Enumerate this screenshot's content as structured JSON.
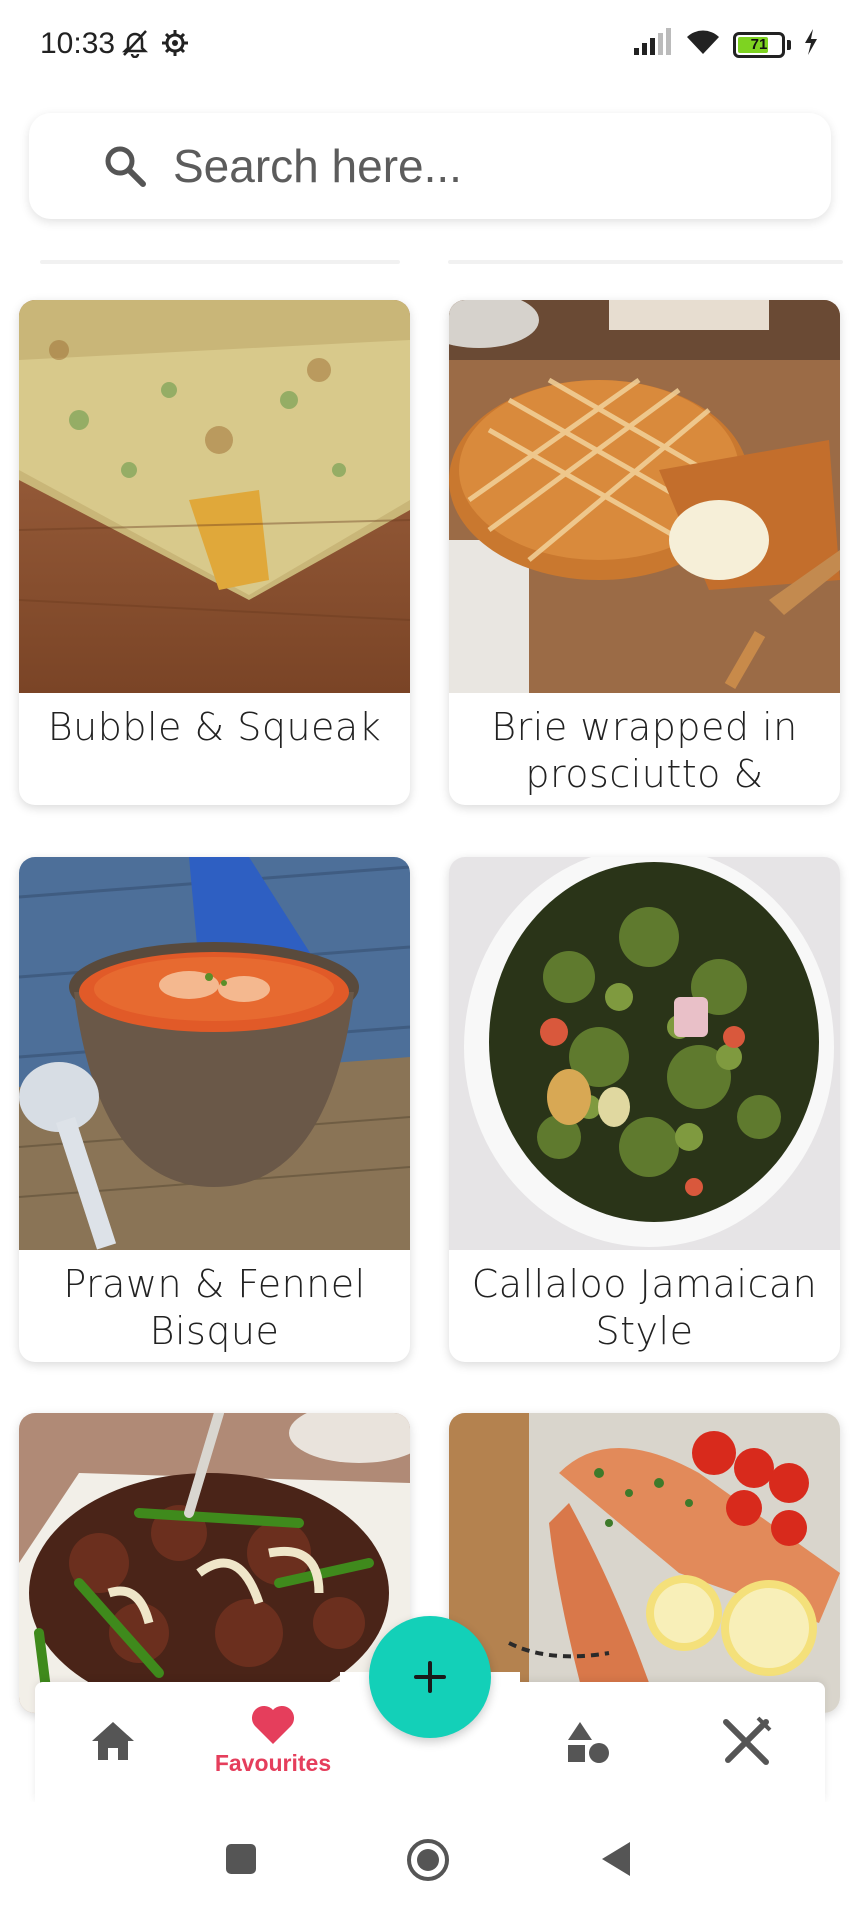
{
  "status_bar": {
    "time": "10:33",
    "battery": "71",
    "icons": [
      "mute-bell-icon",
      "settings-gear-icon",
      "signal-icon",
      "wifi-icon",
      "battery-icon",
      "charging-icon"
    ]
  },
  "search": {
    "placeholder": "Search here..."
  },
  "recipes": [
    {
      "title": "Bubble & Squeak",
      "image": "bubble-squeak-photo"
    },
    {
      "title": "Brie wrapped in prosciutto & brioche",
      "image": "brie-brioche-photo"
    },
    {
      "title": "Prawn & Fennel Bisque",
      "image": "prawn-bisque-photo"
    },
    {
      "title": "Callaloo Jamaican Style",
      "image": "callaloo-photo"
    },
    {
      "title": "",
      "image": "beef-stir-fry-photo"
    },
    {
      "title": "",
      "image": "salmon-lemon-photo"
    }
  ],
  "bottom_nav": {
    "items": [
      {
        "icon": "home-icon",
        "label": ""
      },
      {
        "icon": "heart-icon",
        "label": "Favourites"
      },
      {
        "icon": "shapes-icon",
        "label": ""
      },
      {
        "icon": "fork-knife-icon",
        "label": ""
      }
    ],
    "fab_icon": "plus-icon"
  },
  "colors": {
    "accent": "#e53e5c",
    "fab": "#13d0b8"
  }
}
